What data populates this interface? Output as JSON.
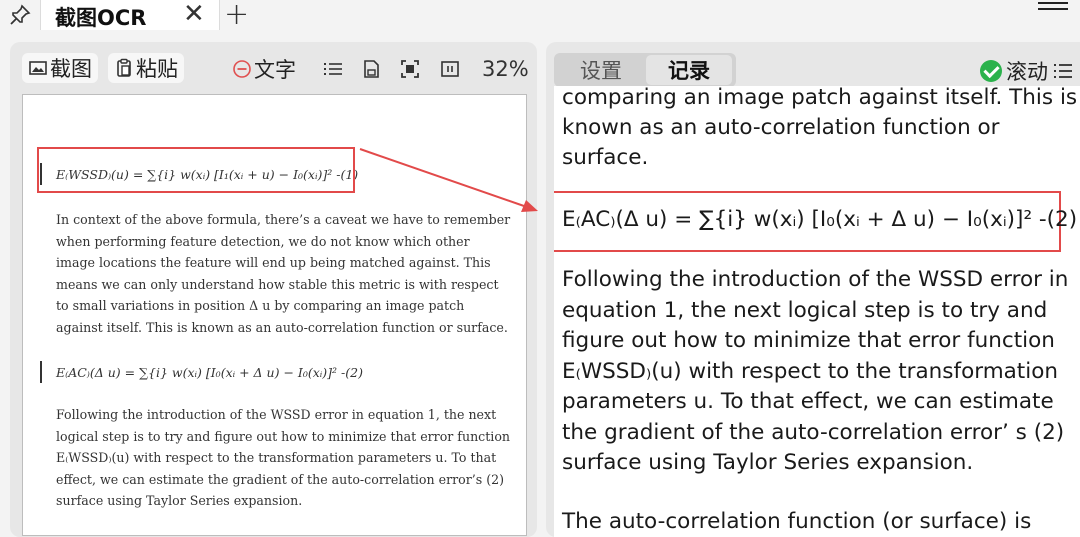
{
  "titlebar": {
    "tab_title": "截图OCR",
    "close_glyph": "✕",
    "new_tab_glyph": "+"
  },
  "left_toolbar": {
    "screenshot_label": "截图",
    "paste_label": "粘贴",
    "text_label": "文字",
    "zoom": "32%"
  },
  "document": {
    "formula1": "E₍WSSD₎(u) = ∑{i} w(xᵢ) [I₁(xᵢ + u) − I₀(xᵢ)]² -(1)",
    "para1": "In context of the above formula, there’s a caveat we have to remember when performing feature detection, we do not know which other image locations the feature will end up being matched against. This means we can only understand how stable this metric is with respect to small variations in position Δ u by comparing an image patch against itself. This is known as an auto-correlation function or surface.",
    "formula2": "E₍AC₎(Δ u) = ∑{i} w(xᵢ) [I₀(xᵢ + Δ u) − I₀(xᵢ)]² -(2)",
    "para2": "Following the introduction of the WSSD error in equation 1, the next logical step is to try and figure out how to minimize that error function E₍WSSD₎(u) with respect to the transformation parameters u. To that effect, we can estimate the gradient of the auto-correlation error’s (2) surface using Taylor Series expansion."
  },
  "right_panel": {
    "tab_settings": "设置",
    "tab_records": "记录",
    "scroll_label": "滚动",
    "lines": [
      "comparing an image patch against itself. This is",
      "known as an auto-correlation function or",
      "surface.",
      "E₍AC₎(Δ u) = ∑{i} w(xᵢ) [I₀(xᵢ + Δ u) − I₀(xᵢ)]² -(2)",
      "Following the introduction of the WSSD error in",
      "equation 1, the next logical step is to try and",
      "figure out how to minimize that error function",
      "E₍WSSD₎(u) with respect to the transformation",
      "parameters u. To that effect, we can estimate",
      "the gradient of the auto-correlation error’ s (2)",
      "surface using Taylor Series expansion.",
      "The auto-correlation function (or surface) is"
    ]
  },
  "colors": {
    "highlight": "#e24a4a",
    "check": "#2bb24c"
  },
  "icons": [
    "pin-icon",
    "screenshot-icon",
    "paste-icon",
    "minus-circle-icon",
    "list-icon",
    "save-icon",
    "scan-icon",
    "columns-icon",
    "check-icon",
    "menu-icon"
  ]
}
